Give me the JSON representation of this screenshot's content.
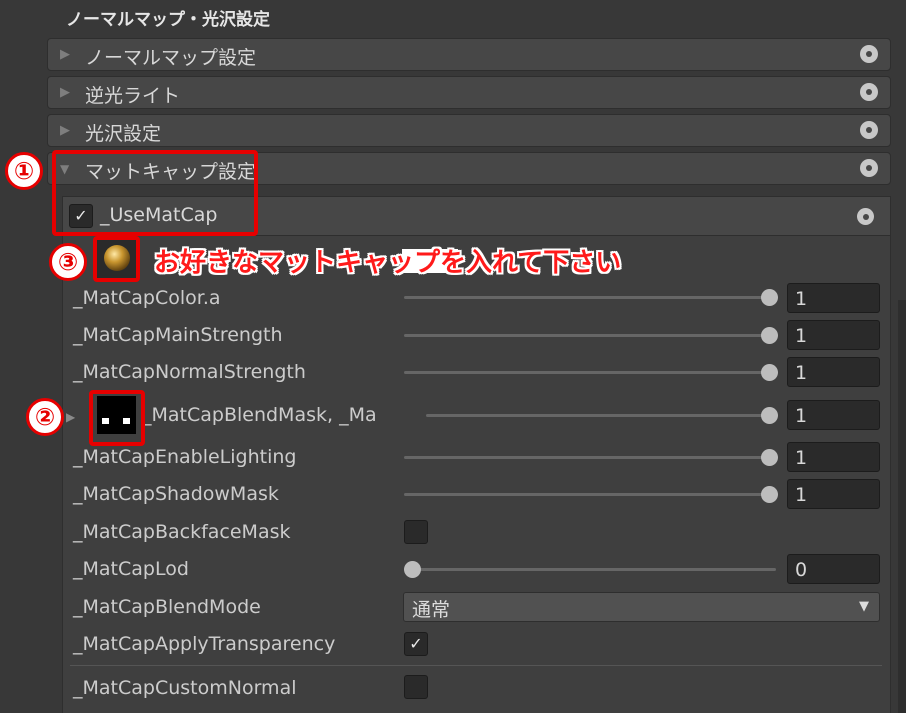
{
  "section_title": "ノーマルマップ・光沢設定",
  "foldouts": [
    {
      "label": "ノーマルマップ設定"
    },
    {
      "label": "逆光ライト"
    },
    {
      "label": "光沢設定"
    },
    {
      "label": "マットキャップ設定"
    }
  ],
  "matcap": {
    "toggle_label": "_UseMatCap",
    "toggle_checked": true,
    "texture_field_label": "_MatCap",
    "blend_mask_label": "_MatCapBlendMask, _Ma"
  },
  "properties": [
    {
      "label": "_MatCapColor.a",
      "value": "1",
      "slider": 1.0
    },
    {
      "label": "_MatCapMainStrength",
      "value": "1",
      "slider": 1.0
    },
    {
      "label": "_MatCapNormalStrength",
      "value": "1",
      "slider": 1.0
    },
    {
      "label": "_MatCapBlendMask, _Ma",
      "value": "1",
      "slider": 1.0
    },
    {
      "label": "_MatCapEnableLighting",
      "value": "1",
      "slider": 1.0
    },
    {
      "label": "_MatCapShadowMask",
      "value": "1",
      "slider": 1.0
    },
    {
      "label": "_MatCapBackfaceMask",
      "checked": false
    },
    {
      "label": "_MatCapLod",
      "value": "0",
      "slider": 0.0
    },
    {
      "label": "_MatCapBlendMode",
      "select_value": "通常"
    },
    {
      "label": "_MatCapApplyTransparency",
      "checked": true
    },
    {
      "label": "_MatCapCustomNormal",
      "checked": false
    }
  ],
  "annotations": {
    "marker_1": "①",
    "marker_2": "②",
    "marker_3": "③",
    "note_text": "お好きなマットキャップを入れて下さい"
  },
  "colors": {
    "annotation_red": "#e60000",
    "panel_bg": "#3f3f3f",
    "header_bg": "#474747"
  }
}
